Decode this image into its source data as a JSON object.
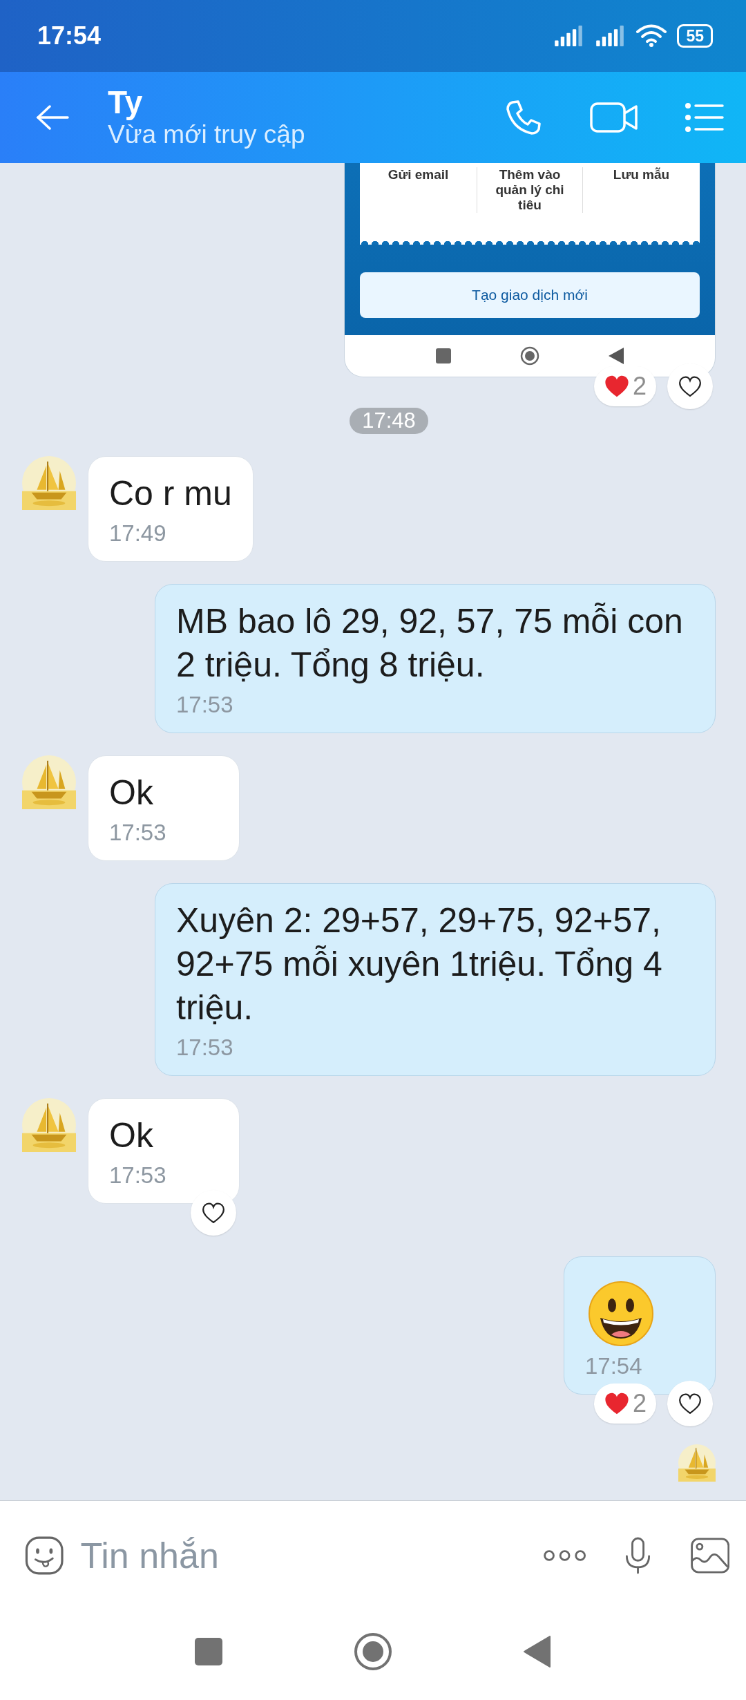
{
  "status_bar": {
    "time": "17:54",
    "battery": "55"
  },
  "header": {
    "title": "Ty",
    "subtitle": "Vừa mới truy cập"
  },
  "messages": [
    {
      "kind": "sent_screenshot",
      "actions": [
        "Gửi email",
        "Thêm vào quản lý chi tiêu",
        "Lưu mẫu"
      ],
      "button": "Tạo giao dịch mới",
      "reaction_count": "2",
      "like_button": true
    },
    {
      "kind": "time_divider",
      "text": "17:48"
    },
    {
      "kind": "received",
      "text": "Co r mu",
      "time": "17:49",
      "like_button": false
    },
    {
      "kind": "sent",
      "text": "MB bao lô 29, 92, 57, 75 mỗi con 2 triệu. Tổng 8 triệu.",
      "time": "17:53",
      "like_button": false
    },
    {
      "kind": "received",
      "text": "Ok",
      "time": "17:53",
      "like_button": false
    },
    {
      "kind": "sent",
      "text": "Xuyên 2: 29+57, 29+75, 92+57, 92+75 mỗi xuyên 1triệu. Tổng 4 triệu.",
      "time": "17:53",
      "like_button": false
    },
    {
      "kind": "received",
      "text": "Ok",
      "time": "17:53",
      "like_button": true
    },
    {
      "kind": "sent_emoji",
      "time": "17:54",
      "reaction_count": "2",
      "like_button": true
    },
    {
      "kind": "seen"
    }
  ],
  "composer": {
    "placeholder": "Tin nhắn"
  }
}
